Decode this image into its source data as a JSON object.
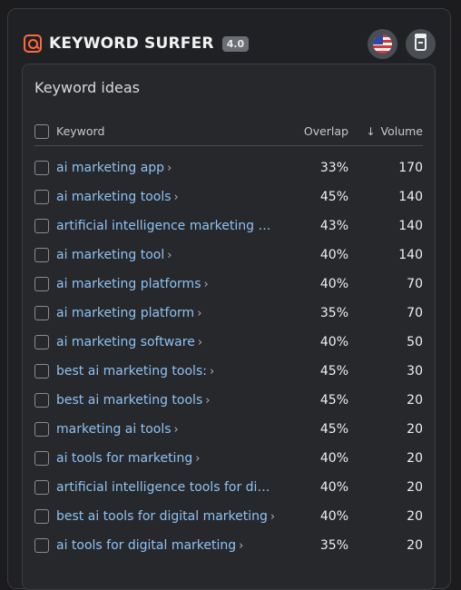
{
  "header": {
    "app_title": "KEYWORD SURFER",
    "version": "4.0",
    "logo_icon": "search-box-icon",
    "country_icon": "us-flag-icon",
    "clipboard_icon": "clipboard-icon",
    "accent": "#ff6a3d"
  },
  "card": {
    "title": "Keyword ideas",
    "columns": {
      "keyword": "Keyword",
      "overlap": "Overlap",
      "volume": "Volume",
      "sort_icon": "arrow-down-icon"
    }
  },
  "rows": [
    {
      "keyword": "ai marketing app",
      "overlap": "33%",
      "volume": "170",
      "chevron": true
    },
    {
      "keyword": "ai marketing tools",
      "overlap": "45%",
      "volume": "140",
      "chevron": true
    },
    {
      "keyword": "artificial intelligence marketing too...",
      "overlap": "43%",
      "volume": "140",
      "chevron": false
    },
    {
      "keyword": "ai marketing tool",
      "overlap": "40%",
      "volume": "140",
      "chevron": true
    },
    {
      "keyword": "ai marketing platforms",
      "overlap": "40%",
      "volume": "70",
      "chevron": true
    },
    {
      "keyword": "ai marketing platform",
      "overlap": "35%",
      "volume": "70",
      "chevron": true
    },
    {
      "keyword": "ai marketing software",
      "overlap": "40%",
      "volume": "50",
      "chevron": true
    },
    {
      "keyword": "best ai marketing tools:",
      "overlap": "45%",
      "volume": "30",
      "chevron": true
    },
    {
      "keyword": "best ai marketing tools",
      "overlap": "45%",
      "volume": "20",
      "chevron": true
    },
    {
      "keyword": "marketing ai tools",
      "overlap": "45%",
      "volume": "20",
      "chevron": true
    },
    {
      "keyword": "ai tools for marketing",
      "overlap": "40%",
      "volume": "20",
      "chevron": true
    },
    {
      "keyword": "artificial intelligence tools for digit...",
      "overlap": "40%",
      "volume": "20",
      "chevron": false
    },
    {
      "keyword": "best ai tools for digital marketing",
      "overlap": "40%",
      "volume": "20",
      "chevron": true
    },
    {
      "keyword": "ai tools for digital marketing",
      "overlap": "35%",
      "volume": "20",
      "chevron": true
    }
  ]
}
